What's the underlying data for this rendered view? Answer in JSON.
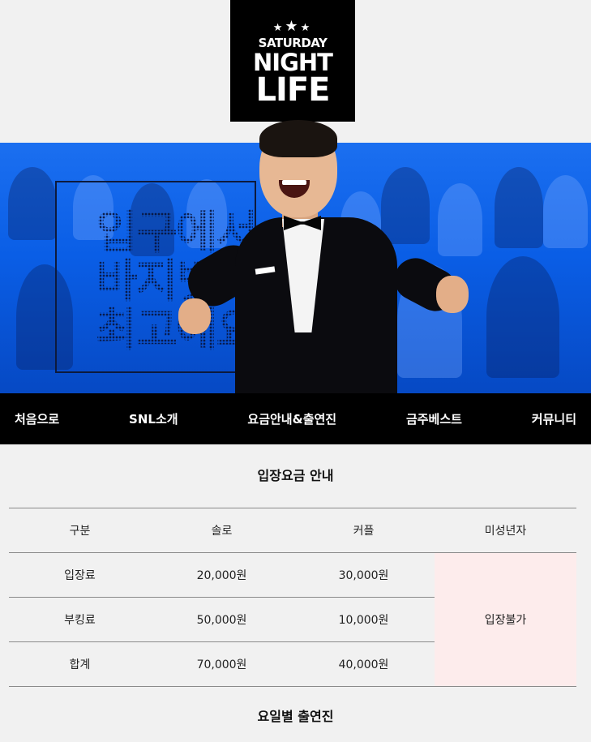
{
  "logo": {
    "line1": "SATURDAY",
    "line2": "NIGHT",
    "line3": "LIFE"
  },
  "banner": {
    "headline": "입구에서\n바지벗으\n최고예요"
  },
  "nav": {
    "items": [
      {
        "label": "처음으로"
      },
      {
        "label": "SNL소개"
      },
      {
        "label": "요금안내&출연진"
      },
      {
        "label": "금주베스트"
      },
      {
        "label": "커뮤니티"
      }
    ]
  },
  "fees": {
    "title": "입장요금 안내",
    "headers": [
      "구분",
      "솔로",
      "커플",
      "미성년자"
    ],
    "rows": [
      {
        "label": "입장료",
        "solo": "20,000원",
        "couple": "30,000원"
      },
      {
        "label": "부킹료",
        "solo": "50,000원",
        "couple": "10,000원"
      },
      {
        "label": "합계",
        "solo": "70,000원",
        "couple": "40,000원"
      }
    ],
    "minor_note": "입장불가"
  },
  "lineup": {
    "title": "요일별 출연진"
  },
  "colors": {
    "brand_blue": "#0a5ee6",
    "nav_bg": "#000000",
    "minor_bg": "#fdecec"
  }
}
